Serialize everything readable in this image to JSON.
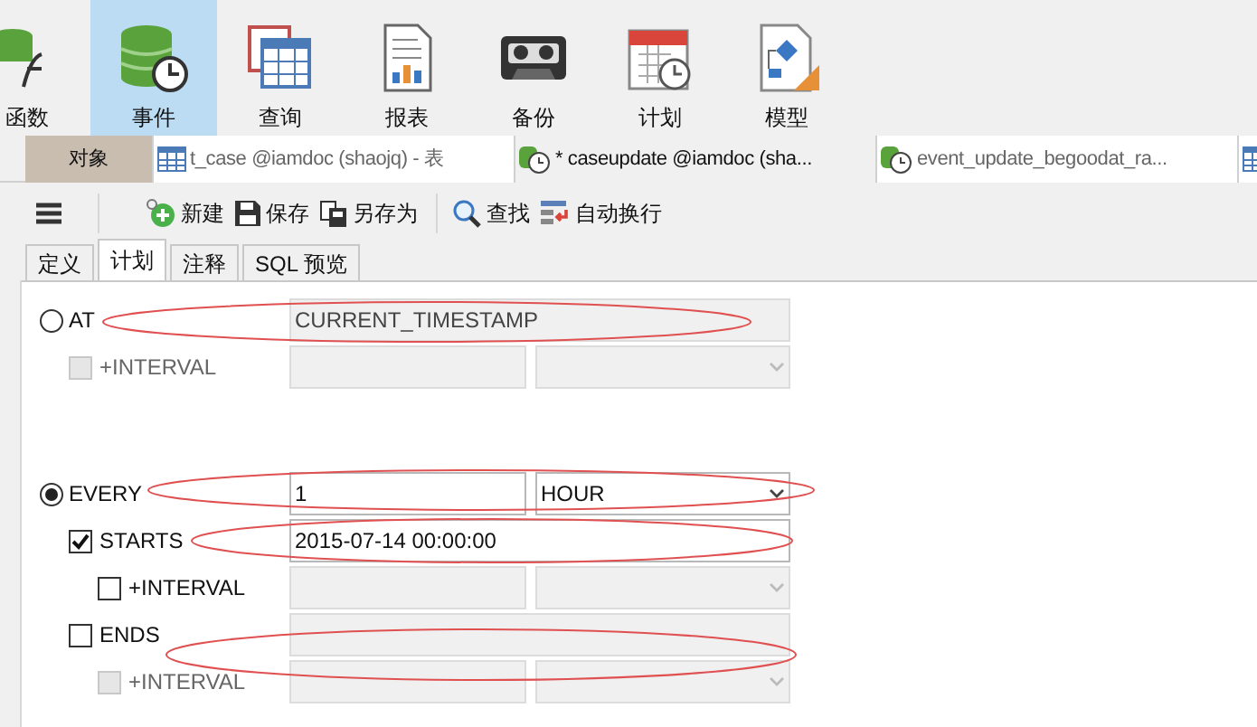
{
  "ribbon": [
    {
      "label": "函数",
      "kind": "function",
      "selected": false
    },
    {
      "label": "事件",
      "kind": "event",
      "selected": true
    },
    {
      "label": "查询",
      "kind": "query",
      "selected": false
    },
    {
      "label": "报表",
      "kind": "report",
      "selected": false
    },
    {
      "label": "备份",
      "kind": "backup",
      "selected": false
    },
    {
      "label": "计划",
      "kind": "schedule",
      "selected": false
    },
    {
      "label": "模型",
      "kind": "model",
      "selected": false
    }
  ],
  "doc_tabs": [
    {
      "label": "对象",
      "kind": "object",
      "selected": false
    },
    {
      "label": "t_case @iamdoc (shaojq) - 表",
      "kind": "table",
      "selected": false
    },
    {
      "label": "* caseupdate @iamdoc (sha...",
      "kind": "event",
      "selected": true
    },
    {
      "label": "event_update_begoodat_ra...",
      "kind": "event",
      "selected": false
    },
    {
      "kind": "table",
      "selected": false
    }
  ],
  "actions": [
    {
      "label": "新建",
      "kind": "new"
    },
    {
      "label": "保存",
      "kind": "save"
    },
    {
      "label": "另存为",
      "kind": "saveas"
    },
    {
      "label": "查找",
      "kind": "find"
    },
    {
      "label": "自动换行",
      "kind": "wrap"
    }
  ],
  "sub_tabs": [
    {
      "label": "定义",
      "selected": false
    },
    {
      "label": "计划",
      "selected": true
    },
    {
      "label": "注释",
      "selected": false
    },
    {
      "label": "SQL 预览",
      "selected": false
    }
  ],
  "schedule": {
    "at": {
      "label": "AT",
      "selected": false,
      "value": "CURRENT_TIMESTAMP"
    },
    "at_interval": {
      "label": "+INTERVAL",
      "checked": false,
      "disabled": true
    },
    "every": {
      "label": "EVERY",
      "selected": true,
      "value": "1",
      "unit": "HOUR"
    },
    "starts": {
      "label": "STARTS",
      "checked": true,
      "value": "2015-07-14 00:00:00"
    },
    "starts_interval": {
      "label": "+INTERVAL",
      "checked": false,
      "disabled": false
    },
    "ends": {
      "label": "ENDS",
      "checked": false
    },
    "ends_interval": {
      "label": "+INTERVAL",
      "checked": false,
      "disabled": true
    }
  }
}
